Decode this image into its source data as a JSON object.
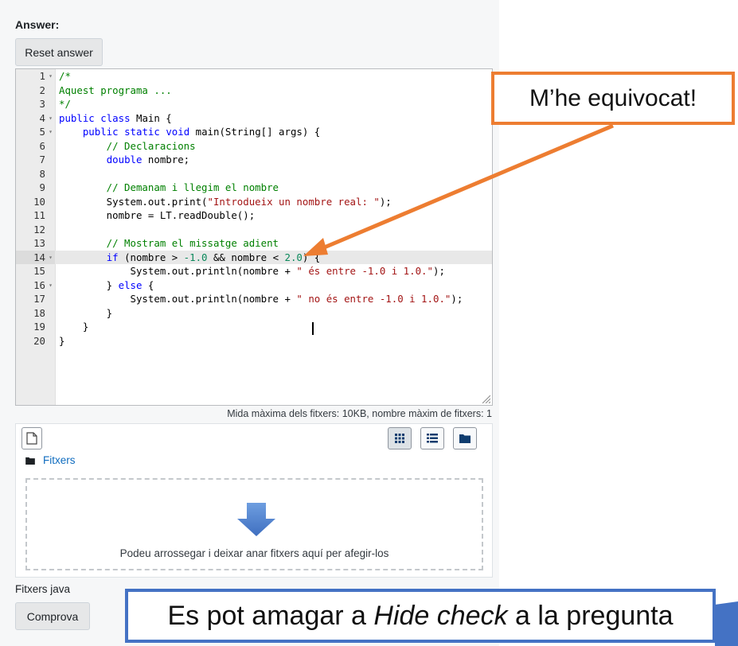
{
  "question": {
    "answer_label": "Answer:",
    "reset_label": "Reset answer",
    "check_label": "Comprova",
    "file_type_label": "Fitxers java"
  },
  "editor": {
    "lines": [
      "/*",
      "Aquest programa ...",
      "*/",
      "public class Main {",
      "    public static void main(String[] args) {",
      "        // Declaracions",
      "        double nombre;",
      "",
      "        // Demanam i llegim el nombre",
      "        System.out.print(\"Introdueix un nombre real: \");",
      "        nombre = LT.readDouble();",
      "",
      "        // Mostram el missatge adient",
      "        if (nombre > -1.0 && nombre < 2.0) {",
      "            System.out.println(nombre + \" és entre -1.0 i 1.0.\");",
      "        } else {",
      "            System.out.println(nombre + \" no és entre -1.0 i 1.0.\");",
      "        }",
      "    }",
      "}"
    ],
    "fold_lines": [
      1,
      4,
      5,
      14,
      16
    ],
    "active_line": 14
  },
  "file_manager": {
    "limits": "Mida màxima dels fitxers: 10KB, nombre màxim de fitxers: 1",
    "breadcrumb": "Fitxers",
    "drop_text": "Podeu arrossegar i deixar anar fitxers aquí per afegir-los"
  },
  "annotations": {
    "top_note": "M’he equivocat!",
    "bottom_prefix": "Es pot amagar a ",
    "bottom_italic": "Hide check",
    "bottom_suffix": " a la pregunta",
    "colors": {
      "orange": "#ed7d31",
      "blue": "#4472c4"
    }
  }
}
